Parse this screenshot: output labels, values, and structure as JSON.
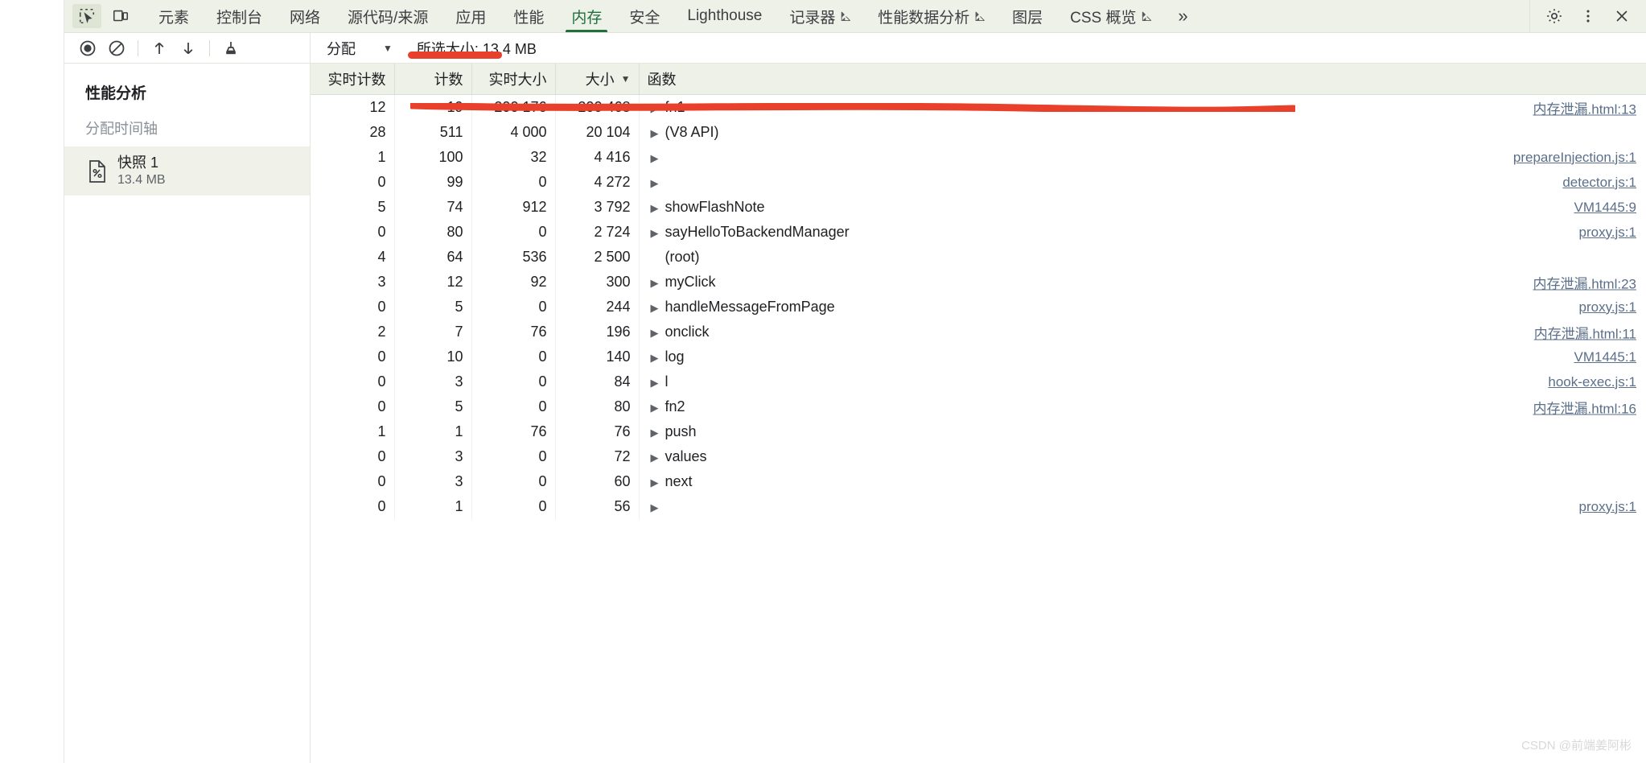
{
  "tabbar": {
    "inspect_icon": "inspect-element-icon",
    "device_icon": "device-toolbar-icon",
    "tabs": [
      {
        "label": "元素",
        "flask": false,
        "active": false
      },
      {
        "label": "控制台",
        "flask": false,
        "active": false
      },
      {
        "label": "网络",
        "flask": false,
        "active": false
      },
      {
        "label": "源代码/来源",
        "flask": false,
        "active": false
      },
      {
        "label": "应用",
        "flask": false,
        "active": false
      },
      {
        "label": "性能",
        "flask": false,
        "active": false
      },
      {
        "label": "内存",
        "flask": false,
        "active": true
      },
      {
        "label": "安全",
        "flask": false,
        "active": false
      },
      {
        "label": "Lighthouse",
        "flask": false,
        "active": false
      },
      {
        "label": "记录器",
        "flask": true,
        "active": false
      },
      {
        "label": "性能数据分析",
        "flask": true,
        "active": false
      },
      {
        "label": "图层",
        "flask": false,
        "active": false
      },
      {
        "label": "CSS 概览",
        "flask": true,
        "active": false
      }
    ],
    "more_label": "»",
    "settings_icon": "gear-icon",
    "kebab_icon": "more-vertical-icon",
    "close_icon": "close-icon"
  },
  "toolbar": {
    "record_icon": "record-circle-icon",
    "clear_icon": "clear-prohibited-icon",
    "load_icon": "upload-arrow-icon",
    "save_icon": "download-arrow-icon",
    "gc_icon": "collect-garbage-icon",
    "view_select_value": "分配",
    "view_select_caret": "▼",
    "selected_size_label": "所选大小: 13.4 MB"
  },
  "sidebar": {
    "title": "性能分析",
    "section": "分配时间轴",
    "snapshot": {
      "icon": "snapshot-document-icon",
      "name": "快照 1",
      "size": "13.4 MB"
    }
  },
  "table": {
    "columns": [
      {
        "label": "实时计数",
        "align": "num",
        "sorted": false
      },
      {
        "label": "计数",
        "align": "num",
        "sorted": false
      },
      {
        "label": "实时大小",
        "align": "num",
        "sorted": false
      },
      {
        "label": "大小",
        "align": "num",
        "sorted": true,
        "sort_caret": "▼"
      },
      {
        "label": "函数",
        "align": "text",
        "sorted": false
      }
    ],
    "rows": [
      {
        "live_count": "12",
        "count": "19",
        "live_size": "200 176",
        "size": "200 468",
        "twisty": "▶",
        "fn": "fn1",
        "link": "内存泄漏.html:13"
      },
      {
        "live_count": "28",
        "count": "511",
        "live_size": "4 000",
        "size": "20 104",
        "twisty": "▶",
        "fn": "(V8 API)",
        "link": ""
      },
      {
        "live_count": "1",
        "count": "100",
        "live_size": "32",
        "size": "4 416",
        "twisty": "▶",
        "fn": "",
        "link": "prepareInjection.js:1"
      },
      {
        "live_count": "0",
        "count": "99",
        "live_size": "0",
        "size": "4 272",
        "twisty": "▶",
        "fn": "",
        "link": "detector.js:1"
      },
      {
        "live_count": "5",
        "count": "74",
        "live_size": "912",
        "size": "3 792",
        "twisty": "▶",
        "fn": "showFlashNote",
        "link": "VM1445:9"
      },
      {
        "live_count": "0",
        "count": "80",
        "live_size": "0",
        "size": "2 724",
        "twisty": "▶",
        "fn": "sayHelloToBackendManager",
        "link": "proxy.js:1"
      },
      {
        "live_count": "4",
        "count": "64",
        "live_size": "536",
        "size": "2 500",
        "twisty": "",
        "fn": "(root)",
        "link": ""
      },
      {
        "live_count": "3",
        "count": "12",
        "live_size": "92",
        "size": "300",
        "twisty": "▶",
        "fn": "myClick",
        "link": "内存泄漏.html:23"
      },
      {
        "live_count": "0",
        "count": "5",
        "live_size": "0",
        "size": "244",
        "twisty": "▶",
        "fn": "handleMessageFromPage",
        "link": "proxy.js:1"
      },
      {
        "live_count": "2",
        "count": "7",
        "live_size": "76",
        "size": "196",
        "twisty": "▶",
        "fn": "onclick",
        "link": "内存泄漏.html:11"
      },
      {
        "live_count": "0",
        "count": "10",
        "live_size": "0",
        "size": "140",
        "twisty": "▶",
        "fn": "log",
        "link": "VM1445:1"
      },
      {
        "live_count": "0",
        "count": "3",
        "live_size": "0",
        "size": "84",
        "twisty": "▶",
        "fn": "l",
        "link": "hook-exec.js:1"
      },
      {
        "live_count": "0",
        "count": "5",
        "live_size": "0",
        "size": "80",
        "twisty": "▶",
        "fn": "fn2",
        "link": "内存泄漏.html:16"
      },
      {
        "live_count": "1",
        "count": "1",
        "live_size": "76",
        "size": "76",
        "twisty": "▶",
        "fn": "push",
        "link": ""
      },
      {
        "live_count": "0",
        "count": "3",
        "live_size": "0",
        "size": "72",
        "twisty": "▶",
        "fn": "values",
        "link": ""
      },
      {
        "live_count": "0",
        "count": "3",
        "live_size": "0",
        "size": "60",
        "twisty": "▶",
        "fn": "next",
        "link": ""
      },
      {
        "live_count": "0",
        "count": "1",
        "live_size": "0",
        "size": "56",
        "twisty": "▶",
        "fn": "",
        "link": "proxy.js:1"
      }
    ]
  },
  "annotations": {
    "marker_color": "#e8402a",
    "underline_target": "分配",
    "strike_target": "fn1 row"
  },
  "watermark": "CSDN @前端姜阿彬"
}
